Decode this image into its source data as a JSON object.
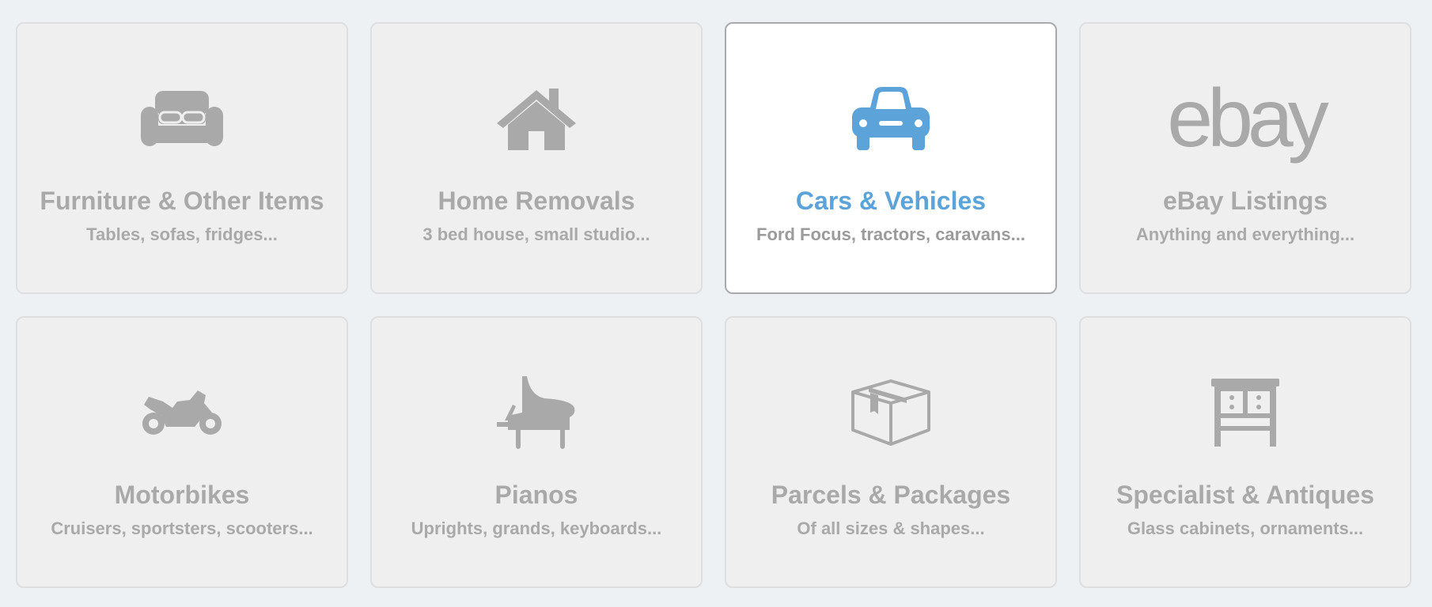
{
  "accent_color": "#5ba3d9",
  "muted_color": "#a9a9a9",
  "cards": [
    {
      "title": "Furniture & Other Items",
      "subtitle": "Tables, sofas, fridges...",
      "icon": "sofa-icon",
      "selected": false
    },
    {
      "title": "Home Removals",
      "subtitle": "3 bed house, small studio...",
      "icon": "house-icon",
      "selected": false
    },
    {
      "title": "Cars & Vehicles",
      "subtitle": "Ford Focus, tractors, caravans...",
      "icon": "car-icon",
      "selected": true
    },
    {
      "title": "eBay Listings",
      "subtitle": "Anything and everything...",
      "icon": "ebay-logo",
      "icon_text": "ebay",
      "selected": false
    },
    {
      "title": "Motorbikes",
      "subtitle": "Cruisers, sportsters, scooters...",
      "icon": "motorbike-icon",
      "selected": false
    },
    {
      "title": "Pianos",
      "subtitle": "Uprights, grands, keyboards...",
      "icon": "grand-piano-icon",
      "selected": false
    },
    {
      "title": "Parcels & Packages",
      "subtitle": "Of all sizes & shapes...",
      "icon": "parcel-box-icon",
      "selected": false
    },
    {
      "title": "Specialist & Antiques",
      "subtitle": "Glass cabinets, ornaments...",
      "icon": "cabinet-icon",
      "selected": false
    }
  ]
}
